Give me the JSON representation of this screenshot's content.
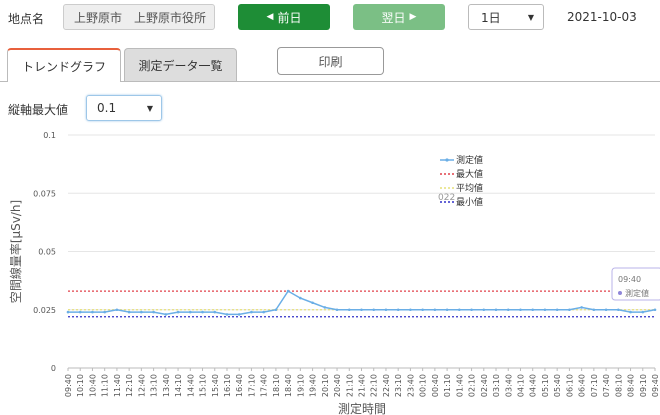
{
  "header": {
    "site_label": "地点名",
    "site_value": "上野原市　上野原市役所",
    "prev_label": "前日",
    "next_label": "翌日",
    "period_value": "1日",
    "date": "2021-10-03"
  },
  "tabs": {
    "trend": "トレンドグラフ",
    "table": "測定データ一覧",
    "print": "印刷"
  },
  "ymax": {
    "label": "縦軸最大値",
    "value": "0.1"
  },
  "colors": {
    "measured": "#6aaee6",
    "max": "#e0404a",
    "avg": "#e6e07a",
    "min": "#3030c8",
    "accent": "#1e8d36"
  },
  "chart_data": {
    "type": "line",
    "ylabel": "空間線量率[μSv/h]",
    "xlabel": "測定時間",
    "ylim": [
      0,
      0.1
    ],
    "yticks": [
      "0",
      "0.025",
      "0.05",
      "0.075",
      "0.1"
    ],
    "x": [
      "09:40",
      "10:10",
      "10:40",
      "11:10",
      "11:40",
      "12:10",
      "12:40",
      "13:10",
      "13:40",
      "14:10",
      "14:40",
      "15:10",
      "15:40",
      "16:10",
      "16:40",
      "17:10",
      "17:40",
      "18:10",
      "18:40",
      "19:10",
      "19:40",
      "20:10",
      "20:40",
      "21:10",
      "21:40",
      "22:10",
      "22:40",
      "23:10",
      "23:40",
      "00:10",
      "00:40",
      "01:10",
      "01:40",
      "02:10",
      "02:40",
      "03:10",
      "03:40",
      "04:10",
      "04:40",
      "05:10",
      "05:40",
      "06:10",
      "06:40",
      "07:10",
      "07:40",
      "08:10",
      "08:40",
      "09:10",
      "09:40"
    ],
    "series": [
      {
        "name": "測定値",
        "values": [
          0.024,
          0.024,
          0.024,
          0.024,
          0.025,
          0.024,
          0.024,
          0.024,
          0.023,
          0.024,
          0.024,
          0.024,
          0.024,
          0.023,
          0.023,
          0.024,
          0.024,
          0.025,
          0.033,
          0.03,
          0.028,
          0.026,
          0.025,
          0.025,
          0.025,
          0.025,
          0.025,
          0.025,
          0.025,
          0.025,
          0.025,
          0.025,
          0.025,
          0.025,
          0.025,
          0.025,
          0.025,
          0.025,
          0.025,
          0.025,
          0.025,
          0.025,
          0.026,
          0.025,
          0.025,
          0.025,
          0.024,
          0.024,
          0.025
        ]
      },
      {
        "name": "最大値",
        "value": 0.033
      },
      {
        "name": "平均値",
        "value": 0.025
      },
      {
        "name": "最小値",
        "value": 0.022
      }
    ],
    "tooltip": {
      "time": "09:40",
      "label": "測定値"
    },
    "legend_partial_value": "022"
  }
}
